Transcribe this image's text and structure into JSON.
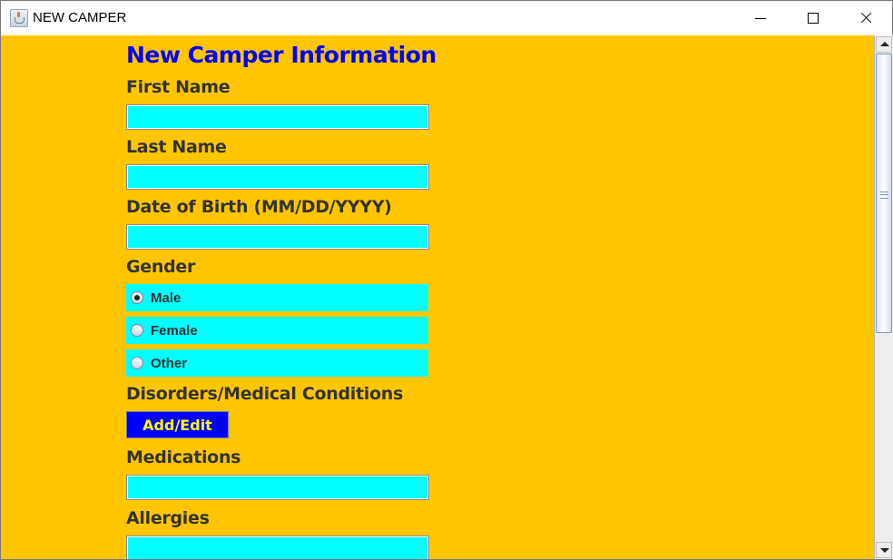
{
  "window": {
    "title": "NEW CAMPER",
    "controls": [
      "minimize",
      "maximize",
      "close"
    ]
  },
  "form": {
    "heading": "New Camper Information",
    "first_name": {
      "label": "First Name",
      "value": ""
    },
    "last_name": {
      "label": "Last Name",
      "value": ""
    },
    "dob": {
      "label": "Date of Birth (MM/DD/YYYY)",
      "value": ""
    },
    "gender": {
      "label": "Gender",
      "options": [
        {
          "label": "Male",
          "selected": true
        },
        {
          "label": "Female",
          "selected": false
        },
        {
          "label": "Other",
          "selected": false
        }
      ]
    },
    "conditions": {
      "label": "Disorders/Medical Conditions",
      "button": "Add/Edit"
    },
    "medications": {
      "label": "Medications",
      "value": ""
    },
    "allergies": {
      "label": "Allergies",
      "value": ""
    }
  },
  "colors": {
    "background": "#ffc600",
    "heading": "#0000ff",
    "field": "#00ffff",
    "button_bg": "#0000ff",
    "button_text": "#ffff00",
    "label": "#333333"
  }
}
